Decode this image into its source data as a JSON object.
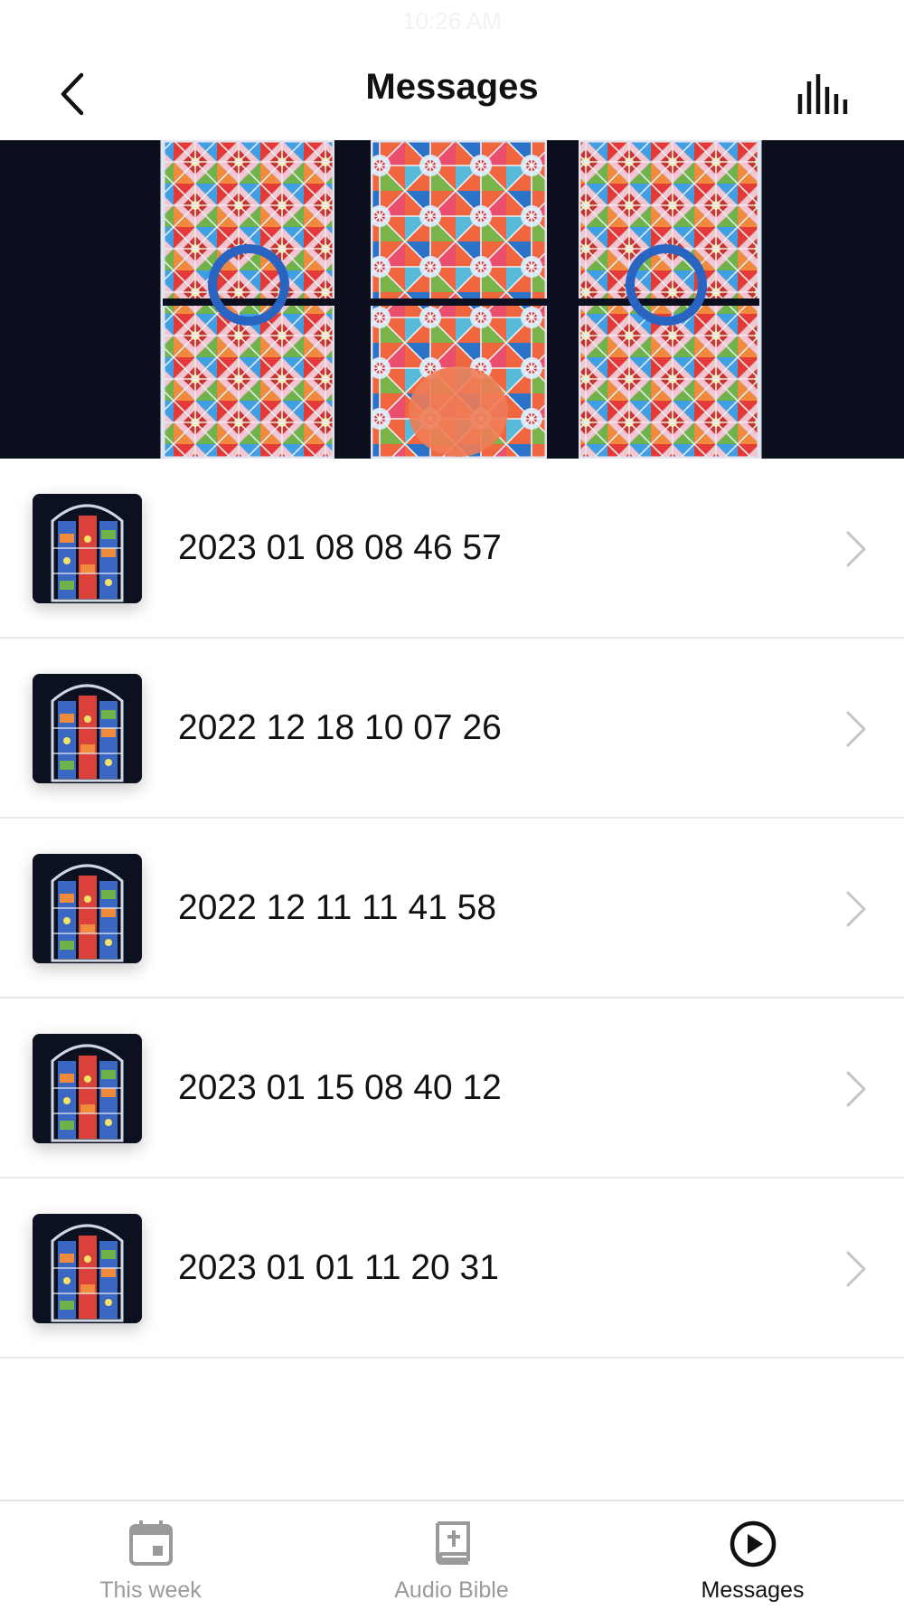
{
  "status_bar": {
    "time": "10:26 AM"
  },
  "nav": {
    "title": "Messages",
    "back_icon": "chevron-left-icon",
    "stats_icon": "bar-chart-icon"
  },
  "hero": {
    "image": "stained-glass-window-banner"
  },
  "messages": [
    {
      "title": "2023 01 08 08 46 57"
    },
    {
      "title": "2022 12 18 10 07 26"
    },
    {
      "title": "2022 12 11 11 41 58"
    },
    {
      "title": "2023 01 15 08 40 12"
    },
    {
      "title": "2023 01 01 11 20 31"
    }
  ],
  "tabbar": {
    "tabs": [
      {
        "label": "This week",
        "icon": "calendar-icon",
        "active": false
      },
      {
        "label": "Audio Bible",
        "icon": "bible-icon",
        "active": false
      },
      {
        "label": "Messages",
        "icon": "play-circle-icon",
        "active": true
      }
    ]
  },
  "colors": {
    "active_tab": "#111111",
    "inactive_tab": "#9a9a9a",
    "divider": "#e8e8e8",
    "chevron": "#c4c4c4"
  }
}
